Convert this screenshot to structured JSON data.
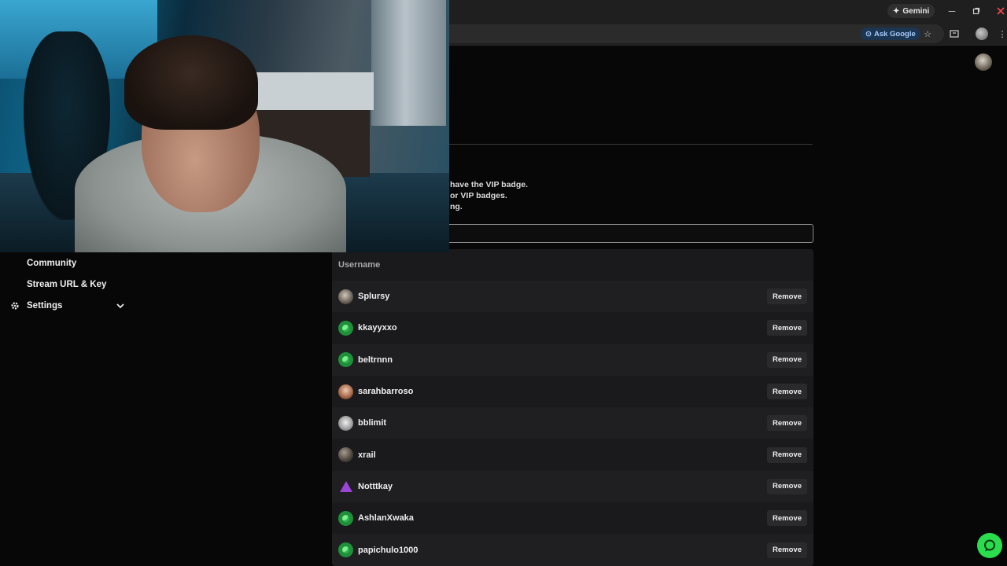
{
  "browser": {
    "gemini_label": "Gemini",
    "ask_google_label": "Ask Google",
    "icons": [
      "minimize-icon",
      "restore-icon",
      "close-icon",
      "star-icon",
      "tab-search-icon",
      "menu-icon"
    ]
  },
  "vip": {
    "description_lines": [
      "have the VIP badge.",
      "or VIP badges.",
      "ng."
    ],
    "input_value": ""
  },
  "table": {
    "header": "Username",
    "remove_label": "Remove",
    "rows": [
      {
        "username": "Splursy",
        "avatar": "photo"
      },
      {
        "username": "kkayyxxo",
        "avatar": "green"
      },
      {
        "username": "beltrnnn",
        "avatar": "green"
      },
      {
        "username": "sarahbarroso",
        "avatar": "woman"
      },
      {
        "username": "bblimit",
        "avatar": "grey"
      },
      {
        "username": "xrail",
        "avatar": "dark"
      },
      {
        "username": "Notttkay",
        "avatar": "tri"
      },
      {
        "username": "AshlanXwaka",
        "avatar": "green"
      },
      {
        "username": "papichulo1000",
        "avatar": "green"
      }
    ]
  },
  "sidebar": {
    "items": [
      {
        "label": "Community"
      },
      {
        "label": "Stream URL & Key"
      },
      {
        "label": "Settings",
        "icon": "gear-icon",
        "expandable": true
      }
    ]
  },
  "colors": {
    "accent_green": "#2bdc4d",
    "background": "#070707",
    "table_bg": "#1a1a1c"
  }
}
